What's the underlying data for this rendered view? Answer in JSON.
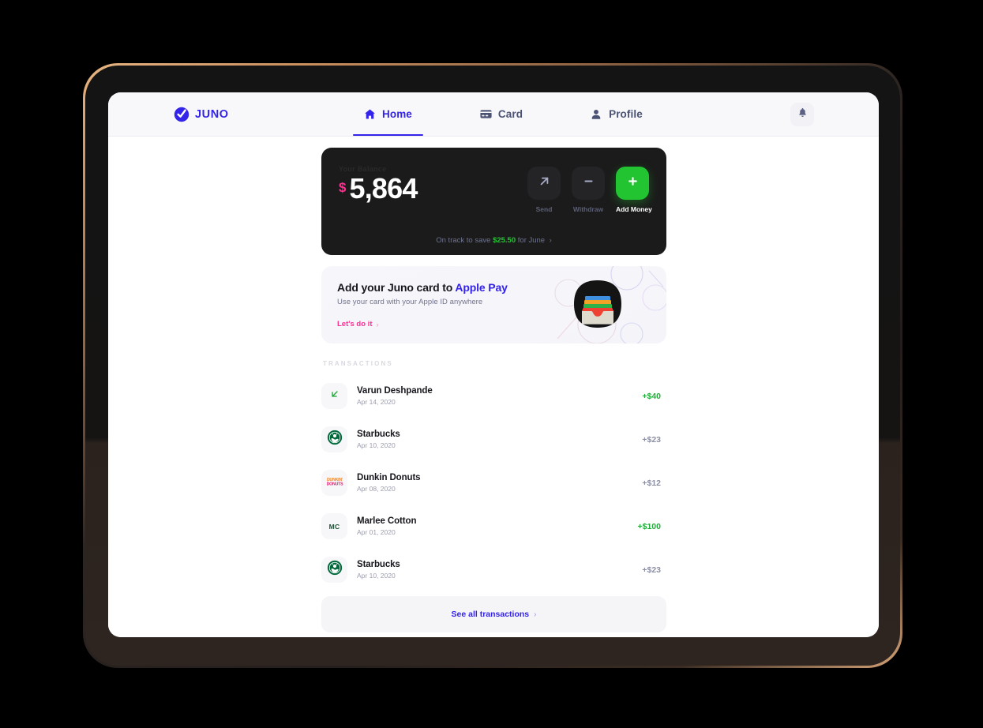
{
  "brand": {
    "name": "JUNO",
    "logo_icon": "juno-check-circle-icon",
    "color": "#3423e8"
  },
  "nav": {
    "tabs": [
      {
        "label": "Home",
        "icon": "home-icon",
        "active": true
      },
      {
        "label": "Card",
        "icon": "card-icon",
        "active": false
      },
      {
        "label": "Profile",
        "icon": "person-icon",
        "active": false
      }
    ],
    "notifications_icon": "bell-icon"
  },
  "balance_card": {
    "label": "Your Balance",
    "currency_symbol": "$",
    "amount": "5,864",
    "currency_color": "#ff2f92",
    "actions": [
      {
        "label": "Send",
        "icon": "arrow-up-right-icon",
        "primary": false
      },
      {
        "label": "Withdraw",
        "icon": "minus-icon",
        "primary": false
      },
      {
        "label": "Add Money",
        "icon": "plus-icon",
        "primary": true
      }
    ],
    "footer": {
      "prefix": "On track to save",
      "highlight": "$25.50",
      "suffix": "for June",
      "chevron": "›",
      "highlight_color": "#22c531"
    }
  },
  "promo": {
    "title_prefix": "Add your Juno card to ",
    "title_brand": "Apple Pay",
    "subtitle": "Use your card with your Apple ID anywhere",
    "cta": "Let's do it",
    "cta_chevron": "›",
    "illustration_icon": "apple-wallet-icon"
  },
  "transactions": {
    "section_title": "TRANSACTIONS",
    "rows": [
      {
        "name": "Varun Deshpande",
        "date": "Apr 14, 2020",
        "amount": "+$40",
        "positive": true,
        "icon": "arrow-down-left-icon",
        "initials": ""
      },
      {
        "name": "Starbucks",
        "date": "Apr 10, 2020",
        "amount": "+$23",
        "positive": false,
        "icon": "starbucks-logo-icon",
        "initials": ""
      },
      {
        "name": "Dunkin Donuts",
        "date": "Apr 08, 2020",
        "amount": "+$12",
        "positive": false,
        "icon": "dunkin-logo-icon",
        "initials": ""
      },
      {
        "name": "Marlee Cotton",
        "date": "Apr 01, 2020",
        "amount": "+$100",
        "positive": true,
        "icon": "initials-avatar-icon",
        "initials": "MC"
      },
      {
        "name": "Starbucks",
        "date": "Apr 10, 2020",
        "amount": "+$23",
        "positive": false,
        "icon": "starbucks-logo-icon",
        "initials": ""
      }
    ],
    "see_all_label": "See all transactions",
    "see_all_chevron": "›"
  }
}
